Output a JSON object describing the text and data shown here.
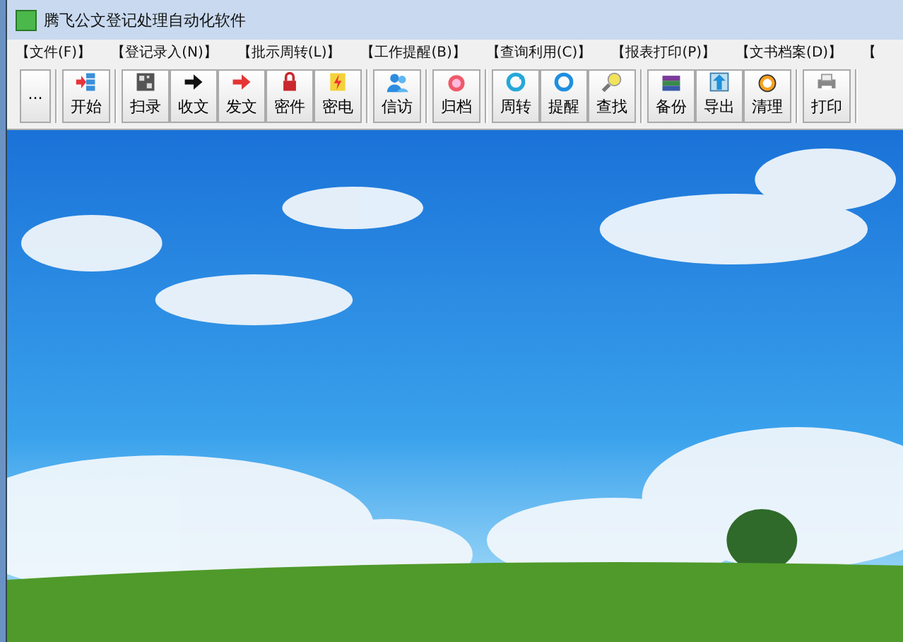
{
  "window": {
    "title": "腾飞公文登记处理自动化软件"
  },
  "menu": [
    "【文件(F)】",
    "【登记录入(N)】",
    "【批示周转(L)】",
    "【工作提醒(B)】",
    "【查询利用(C)】",
    "【报表打印(P)】",
    "【文书档案(D)】",
    "【"
  ],
  "toolbar": [
    {
      "buttons": [
        {
          "label": "...",
          "kind": "more"
        }
      ]
    },
    {
      "buttons": [
        {
          "label": "开始",
          "kind": "start"
        }
      ]
    },
    {
      "buttons": [
        {
          "label": "扫录",
          "kind": "scan"
        },
        {
          "label": "收文",
          "kind": "receive"
        },
        {
          "label": "发文",
          "kind": "send"
        },
        {
          "label": "密件",
          "kind": "secret"
        },
        {
          "label": "密电",
          "kind": "telegram"
        }
      ]
    },
    {
      "buttons": [
        {
          "label": "信访",
          "kind": "visit"
        }
      ]
    },
    {
      "buttons": [
        {
          "label": "归档",
          "kind": "archive"
        }
      ]
    },
    {
      "buttons": [
        {
          "label": "周转",
          "kind": "cycle"
        },
        {
          "label": "提醒",
          "kind": "remind"
        },
        {
          "label": "查找",
          "kind": "search"
        }
      ]
    },
    {
      "buttons": [
        {
          "label": "备份",
          "kind": "backup"
        },
        {
          "label": "导出",
          "kind": "export"
        },
        {
          "label": "清理",
          "kind": "clean"
        }
      ]
    },
    {
      "buttons": [
        {
          "label": "打印",
          "kind": "print"
        }
      ]
    }
  ]
}
